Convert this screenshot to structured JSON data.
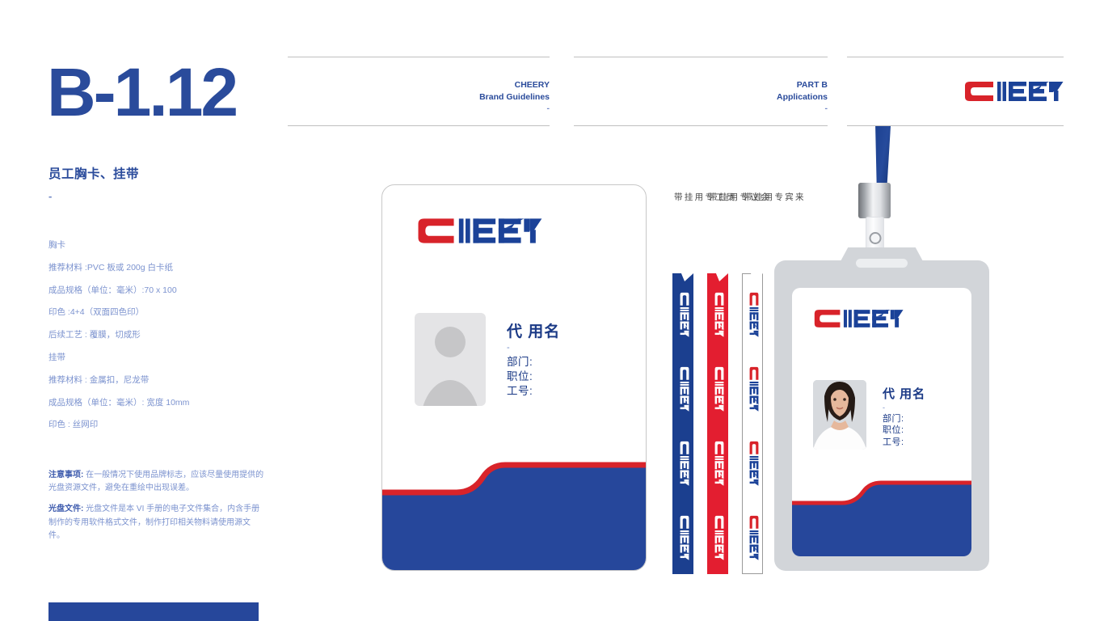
{
  "page": {
    "code": "B-1.12",
    "section_title": "员工胸卡、挂带",
    "dash": "-"
  },
  "colors": {
    "brand_blue": "#26479b",
    "title_blue": "#2a4b9b",
    "body_blue": "#7c93cf",
    "brand_red": "#d8232a",
    "logo_blue": "#1b4298",
    "holder_grey": "#d2d5d9"
  },
  "specs": [
    "胸卡",
    "推荐材料 :PVC 板或 200g 白卡纸",
    "成品规格（单位：毫米）:70 x 100",
    "印色 :4+4（双面四色印）",
    "后续工艺 : 覆膜，切成形",
    "挂带",
    "推荐材料 : 金属扣，尼龙带",
    "成品规格（单位：毫米）: 宽度 10mm",
    "印色 : 丝网印"
  ],
  "notes": [
    {
      "label": "注意事项:",
      "text": " 在一般情况下使用品牌标志，应该尽量使用提供的光盘资源文件，避免在重绘中出现误差。"
    },
    {
      "label": "光盘文件:",
      "text": " 光盘文件是本 VI 手册的电子文件集合，内含手册制作的专用软件格式文件，制作打印相关物料请使用源文件。"
    }
  ],
  "header": {
    "cell1": {
      "line1": "CHEERY",
      "line2": "Brand Guidelines",
      "dash": "-"
    },
    "cell2": {
      "line1": "PART B",
      "line2": "Applications",
      "dash": "-"
    },
    "logo_alt": "cheery-logo"
  },
  "badge_card": {
    "logo_alt": "cheery-logo",
    "name": "代 用名",
    "dash": "-",
    "fields": [
      "部门:",
      "职位:",
      "工号:"
    ],
    "avatar_alt": "person-placeholder-icon"
  },
  "holder_badge": {
    "logo_alt": "cheery-logo",
    "name": "代 用名",
    "dash": "-",
    "fields": [
      "部门:",
      "职位:",
      "工号:"
    ],
    "photo_alt": "employee-photo"
  },
  "lanyards": [
    {
      "label": "员工专用挂带",
      "band_color": "#1b3f8f",
      "logo_style": "white"
    },
    {
      "label": "会议专用挂带",
      "band_color": "#e31e30",
      "logo_style": "white"
    },
    {
      "label": "来宾专用挂带",
      "band_color": "#ffffff",
      "logo_style": "color"
    }
  ]
}
